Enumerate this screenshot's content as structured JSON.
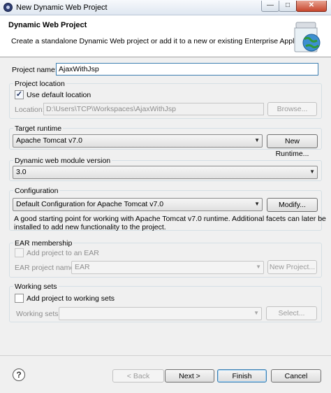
{
  "window": {
    "title": "New Dynamic Web Project",
    "minimize": "—",
    "maximize": "□",
    "close": "✕"
  },
  "banner": {
    "title": "Dynamic Web Project",
    "description": "Create a standalone Dynamic Web project or add it to a new or existing Enterprise Application."
  },
  "project_name": {
    "label": "Project name:",
    "value": "AjaxWithJsp"
  },
  "project_location": {
    "title": "Project location",
    "use_default_label": "Use default location",
    "use_default_checked": true,
    "location_label": "Location:",
    "location_value": "D:\\Users\\TCP\\Workspaces\\AjaxWithJsp",
    "browse_label": "Browse..."
  },
  "target_runtime": {
    "title": "Target runtime",
    "selected": "Apache Tomcat v7.0",
    "new_runtime_label": "New Runtime..."
  },
  "module_version": {
    "title": "Dynamic web module version",
    "selected": "3.0"
  },
  "configuration": {
    "title": "Configuration",
    "selected": "Default Configuration for Apache Tomcat v7.0",
    "modify_label": "Modify...",
    "description_line1": "A good starting point for working with Apache Tomcat v7.0 runtime. Additional facets can later be",
    "description_line2": "installed to add new functionality to the project."
  },
  "ear_membership": {
    "title": "EAR membership",
    "add_label": "Add project to an EAR",
    "ear_name_label": "EAR project name:",
    "ear_name_value": "EAR",
    "new_project_label": "New Project..."
  },
  "working_sets": {
    "title": "Working sets",
    "add_label": "Add project to working sets",
    "working_sets_label": "Working sets:",
    "select_label": "Select..."
  },
  "footer": {
    "help": "?",
    "back_label": "< Back",
    "next_label": "Next >",
    "finish_label": "Finish",
    "cancel_label": "Cancel"
  }
}
